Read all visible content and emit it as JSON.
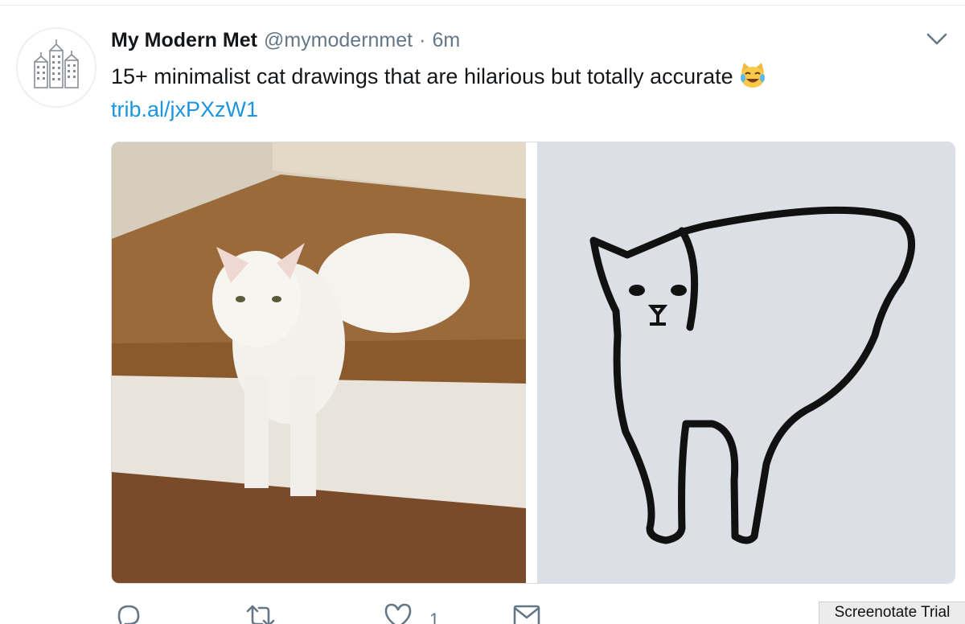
{
  "tweet": {
    "display_name": "My Modern Met",
    "handle": "@mymodernmet",
    "separator": "·",
    "timestamp": "6m",
    "text": "15+ minimalist cat drawings that are hilarious but totally accurate",
    "emoji": "face-with-tears-of-joy-cat",
    "link": "trib.al/jxPXzW1",
    "avatar_icon": "city-buildings-logo-icon",
    "menu_icon": "chevron-down-icon"
  },
  "media": {
    "photos": [
      {
        "name": "white-cat-on-step-photo"
      },
      {
        "name": "minimalist-cat-drawing-photo"
      }
    ]
  },
  "actions": {
    "reply_icon": "reply-icon",
    "retweet_icon": "retweet-icon",
    "like_icon": "heart-icon",
    "like_count": "1",
    "message_icon": "envelope-icon"
  },
  "watermark": {
    "text": "Screenotate Trial"
  },
  "colors": {
    "text_primary": "#14171a",
    "text_secondary": "#657786",
    "link": "#1b95e0",
    "border": "#e6ecf0"
  }
}
